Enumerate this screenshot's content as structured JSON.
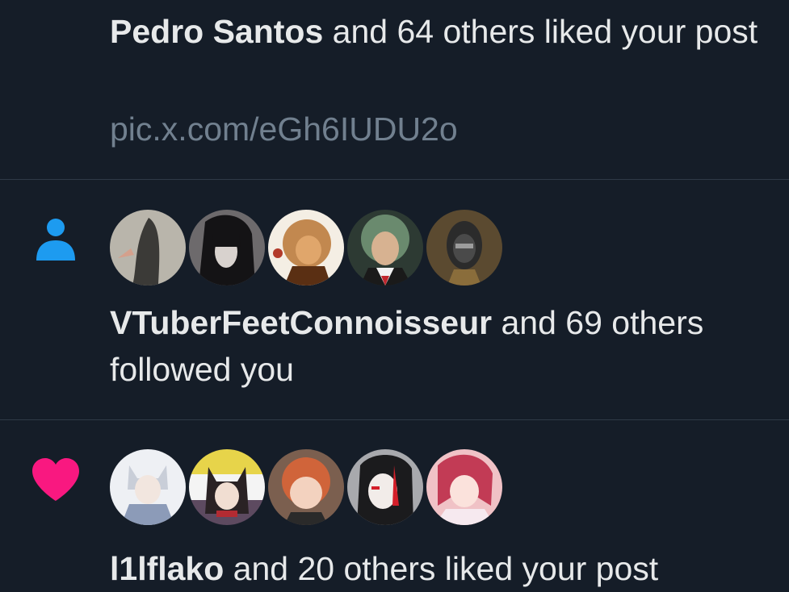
{
  "notifications": [
    {
      "type": "like",
      "actor": "Pedro Santos",
      "rest": " and 64 others liked your post",
      "link": "pic.x.com/eGh6IUDU2o"
    },
    {
      "type": "follow",
      "icon": "person-icon",
      "actor": "VTuberFeetConnoisseur",
      "rest": " and 69 others followed you",
      "avatars": [
        {
          "name": "avatar-1",
          "bg": "#b9b5ab",
          "fg": "#3b3a37"
        },
        {
          "name": "avatar-2",
          "bg": "#6d6a6c",
          "fg": "#141315"
        },
        {
          "name": "avatar-3",
          "bg": "#c2884f",
          "fg": "#5a2f13"
        },
        {
          "name": "avatar-4",
          "bg": "#6a8a6e",
          "fg": "#d7b291"
        },
        {
          "name": "avatar-5",
          "bg": "#5b4a30",
          "fg": "#2b2b2b"
        }
      ]
    },
    {
      "type": "like",
      "icon": "heart-icon",
      "actor": "l1lflako",
      "rest": " and 20 others liked your post",
      "avatars": [
        {
          "name": "avatar-6",
          "bg": "#d9dde6",
          "fg": "#8c9bb8"
        },
        {
          "name": "avatar-7",
          "bg": "#e7d44a",
          "fg": "#5d4a60"
        },
        {
          "name": "avatar-8",
          "bg": "#7b5f4f",
          "fg": "#d0643a"
        },
        {
          "name": "avatar-9",
          "bg": "#a8a9ad",
          "fg": "#1b1b1d"
        },
        {
          "name": "avatar-10",
          "bg": "#f0c2c6",
          "fg": "#c23b55"
        }
      ]
    }
  ],
  "colors": {
    "background": "#151d28",
    "follow_icon": "#1d9bf0",
    "heart_icon": "#f91880",
    "link": "#71808f"
  }
}
